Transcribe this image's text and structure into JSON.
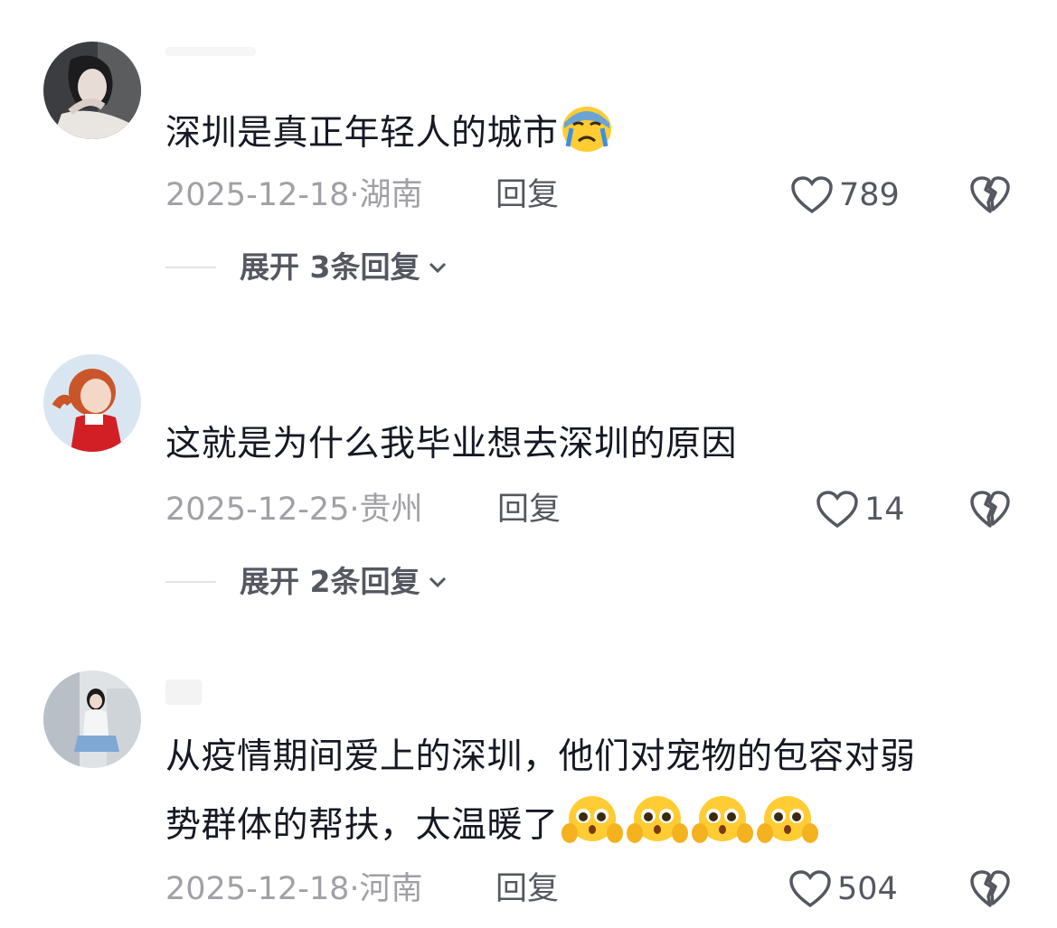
{
  "comments": [
    {
      "text": "深圳是真正年轻人的城市",
      "emojis": [
        "crying-face"
      ],
      "date": "2025-12-18·",
      "location": "湖南",
      "reply_label": "回复",
      "likes": "789",
      "expand_label": "展开 3条回复"
    },
    {
      "text": "这就是为什么我毕业想去深圳的原因",
      "emojis": [],
      "date": "2025-12-25·",
      "location": "贵州",
      "reply_label": "回复",
      "likes": "14",
      "expand_label": "展开 2条回复"
    },
    {
      "text_line1": "从疫情期间爱上的深圳，他们对宠物的包容对弱",
      "text_line2": "势群体的帮扶，太温暖了",
      "emojis": [
        "pleading-face",
        "pleading-face",
        "pleading-face",
        "pleading-face"
      ],
      "date": "2025-12-18·",
      "location": "河南",
      "reply_label": "回复",
      "likes": "504"
    }
  ],
  "icons": {
    "like": "heart-outline-icon",
    "dislike": "broken-heart-icon",
    "expand": "chevron-down-icon"
  },
  "colors": {
    "primary_text": "#161823",
    "meta_text": "#a0a0a6",
    "action_text": "#555860",
    "divider": "#e3e3e6"
  }
}
